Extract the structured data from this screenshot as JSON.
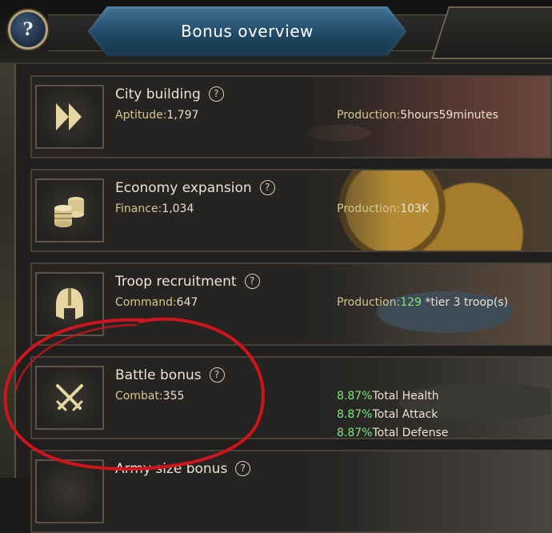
{
  "header": {
    "title": "Bonus overview",
    "help_symbol": "?"
  },
  "cards": [
    {
      "title": "City building",
      "help_symbol": "?",
      "stat_name": "Aptitude:",
      "stat_value": "1,797",
      "production_label": "Production:",
      "production_value": "5hours59minutes",
      "icon": "double-chevron-icon"
    },
    {
      "title": "Economy expansion",
      "help_symbol": "?",
      "stat_name": "Finance:",
      "stat_value": "1,034",
      "production_label": "Production:",
      "production_value": "103K",
      "icon": "coin-stack-icon"
    },
    {
      "title": "Troop recruitment",
      "help_symbol": "?",
      "stat_name": "Command:",
      "stat_value": "647",
      "production_label": "Production:",
      "production_value_green": "129",
      "production_suffix": " *tier 3 troop(s)",
      "icon": "helmet-icon"
    },
    {
      "title": "Battle bonus",
      "help_symbol": "?",
      "stat_name": "Combat:",
      "stat_value": "355",
      "icon": "crossed-swords-icon",
      "bonuses": [
        {
          "percent": "8.87%",
          "label": "Total Health"
        },
        {
          "percent": "8.87%",
          "label": "Total Attack"
        },
        {
          "percent": "8.87%",
          "label": "Total Defense"
        }
      ]
    },
    {
      "title": "Army size bonus",
      "help_symbol": "?"
    }
  ],
  "colors": {
    "accent_green": "#7ee77a",
    "stat_gold": "#d7c58d",
    "annotation_red": "#d0141c"
  }
}
